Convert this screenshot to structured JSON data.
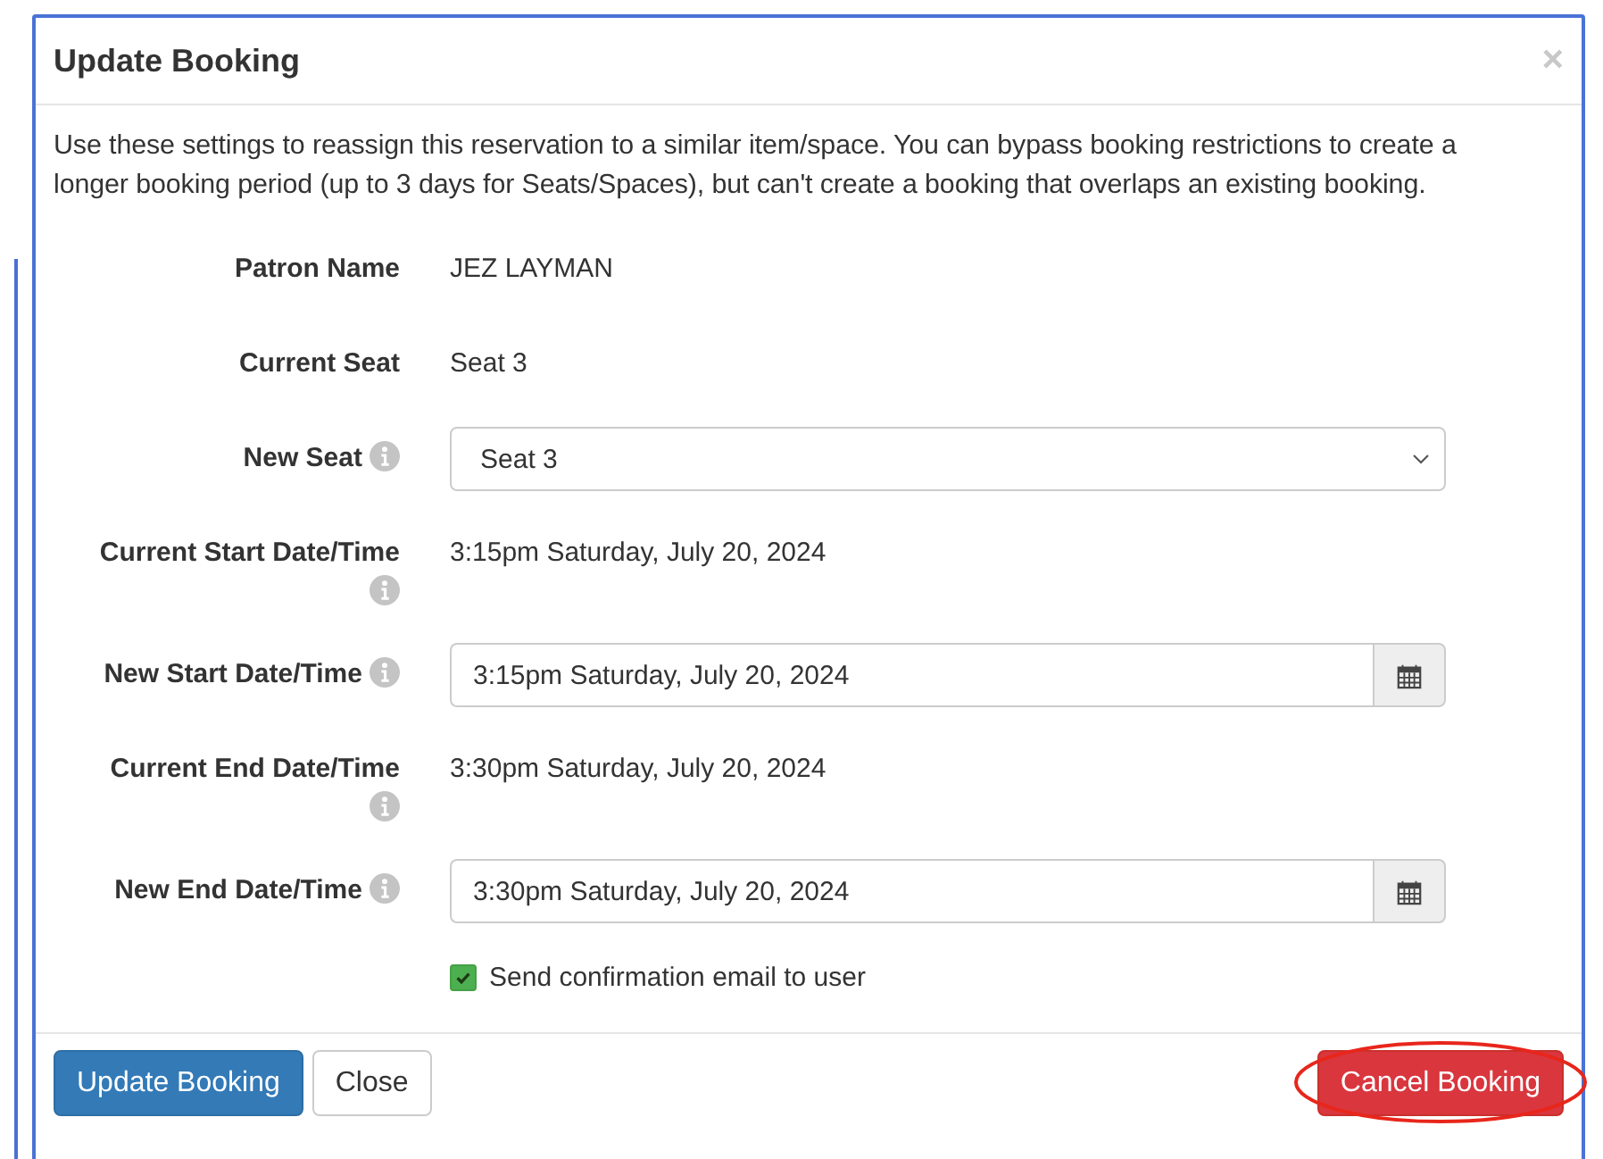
{
  "modal": {
    "title": "Update Booking",
    "close_symbol": "×",
    "intro": "Use these settings to reassign this reservation to a similar item/space. You can bypass booking restrictions to create a longer booking period (up to 3 days for Seats/Spaces), but can't create a booking that overlaps an existing booking.",
    "fields": [
      {
        "kind": "text",
        "label": "Patron Name",
        "info": false,
        "value": "JEZ LAYMAN"
      },
      {
        "kind": "text",
        "label": "Current Seat",
        "info": false,
        "value": "Seat 3"
      },
      {
        "kind": "select",
        "label": "New Seat",
        "info": true,
        "value": "Seat 3"
      },
      {
        "kind": "text",
        "label": "Current Start Date/Time",
        "info": true,
        "value": "3:15pm Saturday, July 20, 2024"
      },
      {
        "kind": "date",
        "label": "New Start Date/Time",
        "info": true,
        "value": "3:15pm Saturday, July 20, 2024"
      },
      {
        "kind": "text",
        "label": "Current End Date/Time",
        "info": true,
        "value": "3:30pm Saturday, July 20, 2024"
      },
      {
        "kind": "date",
        "label": "New End Date/Time",
        "info": true,
        "value": "3:30pm Saturday, July 20, 2024"
      }
    ],
    "send_email": {
      "label": "Send confirmation email to user",
      "checked": true
    },
    "buttons": [
      {
        "kind": "primary",
        "label": "Update Booking",
        "highlighted": false
      },
      {
        "kind": "default",
        "label": "Close",
        "highlighted": false
      },
      {
        "kind": "danger",
        "label": "Cancel Booking",
        "highlighted": true
      }
    ]
  }
}
